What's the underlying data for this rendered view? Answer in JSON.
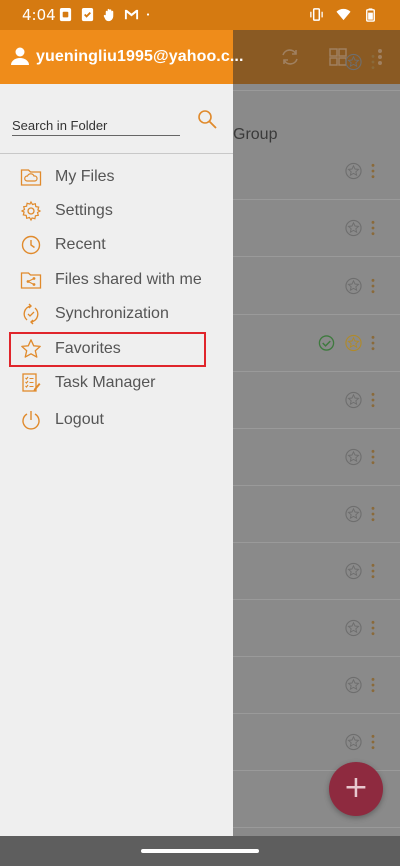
{
  "status_bar": {
    "time": "4:04",
    "left_icons": [
      "document-icon",
      "document-check-icon",
      "hand-icon",
      "gmail-icon",
      "dot-icon"
    ],
    "right_icons": [
      "vibrate-icon",
      "wifi-icon",
      "battery-icon"
    ],
    "color": "#d57a11"
  },
  "drawer": {
    "account_email": "yueningliu1995@yahoo.c...",
    "header_color": "#ef8c1a",
    "search": {
      "placeholder": "Search in Folder",
      "value": ""
    },
    "menu": [
      {
        "label": "My Files",
        "icon": "cloud-folder-icon"
      },
      {
        "label": "Settings",
        "icon": "gear-icon"
      },
      {
        "label": "Recent",
        "icon": "clock-icon"
      },
      {
        "label": "Files shared with me",
        "icon": "shared-folder-icon"
      },
      {
        "label": "Synchronization",
        "icon": "sync-icon"
      },
      {
        "label": "Favorites",
        "icon": "star-icon"
      },
      {
        "label": "Task Manager",
        "icon": "task-list-icon"
      },
      {
        "label": "Logout",
        "icon": "power-icon"
      }
    ],
    "accent_color": "#e08a2c"
  },
  "background_app": {
    "visible_text": "Group",
    "toolbar_icons": [
      "sync-icon",
      "grid-view-icon",
      "more-vert-icon"
    ],
    "fab_label": "+"
  },
  "highlight": {
    "target": "Favorites",
    "color": "#e0252b"
  }
}
